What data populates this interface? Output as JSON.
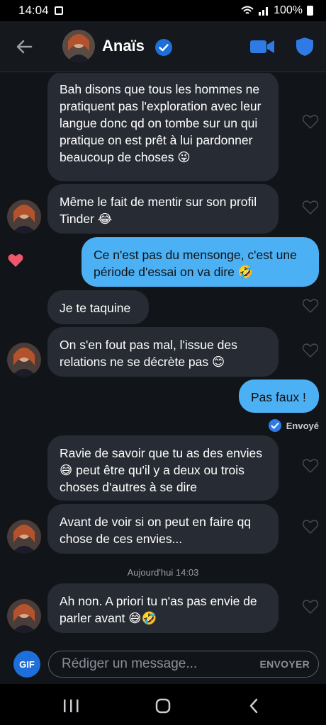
{
  "status": {
    "time": "14:04",
    "battery": "100%"
  },
  "header": {
    "contact_name": "Anaïs"
  },
  "messages": [
    {
      "text": "Bah disons que tous les hommes ne pratiquent pas l'exploration avec leur langue donc qd on tombe sur un qui pratique on est prêt à lui pardonner beaucoup de choses 😜"
    },
    {
      "text": "Même le fait de mentir sur son profil Tinder 😂"
    },
    {
      "text": "Ce n'est pas du mensonge, c'est une période d'essai on va dire 🤣"
    },
    {
      "text": "Je te taquine"
    },
    {
      "text": "On s'en fout pas mal, l'issue des relations ne se décrète pas 😊"
    },
    {
      "text": "Pas faux !"
    },
    {
      "text": "Ravie de savoir que tu as des envies 😅 peut être qu'il y a deux ou trois choses d'autres à se dire"
    },
    {
      "text": "Avant de voir si on peut en faire qq chose de ces envies..."
    },
    {
      "text": "Ah non. A priori tu n'as pas envie de parler avant 😅🤣"
    }
  ],
  "sent_status": "Envoyé",
  "day_separator": {
    "day": "Aujourd'hui",
    "time": "14:03"
  },
  "composer": {
    "gif_label": "GIF",
    "placeholder": "Rédiger un message...",
    "send_label": "ENVOYER"
  },
  "colors": {
    "accent_blue": "#1e6fd9",
    "outgoing_bubble": "#4cb1f4",
    "incoming_bubble": "#272b33",
    "like_heart": "#f0576b"
  }
}
